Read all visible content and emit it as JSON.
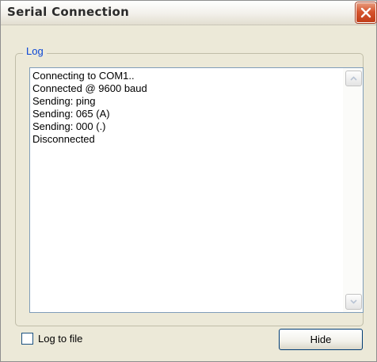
{
  "window": {
    "title": "Serial Connection",
    "close_icon": "close-icon"
  },
  "group": {
    "label": "Log"
  },
  "log": {
    "lines": [
      "Connecting to COM1..",
      "Connected @ 9600 baud",
      "Sending: ping",
      "Sending: 065 (A)",
      "Sending: 000 (.)",
      "Disconnected"
    ]
  },
  "options": {
    "log_to_file_label": "Log to file",
    "log_to_file_checked": false
  },
  "buttons": {
    "hide_label": "Hide"
  },
  "colors": {
    "group_label": "#0a46d6",
    "close_button": "#d6552f",
    "dialog_bg": "#ece9d8"
  }
}
